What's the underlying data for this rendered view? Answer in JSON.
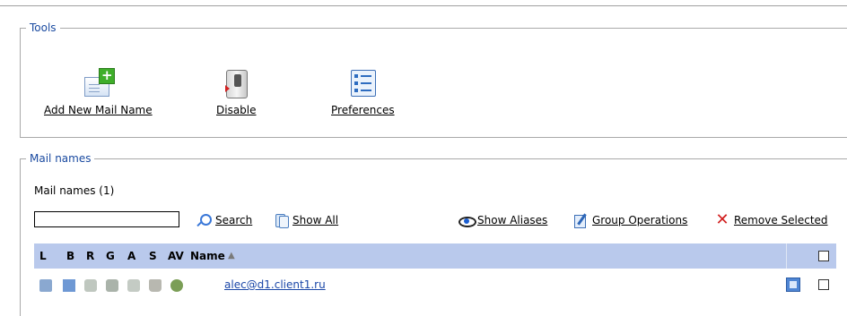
{
  "tools": {
    "legend": "Tools",
    "items": [
      {
        "label": "Add New Mail Name",
        "icon": "add-mail-icon"
      },
      {
        "label": "Disable",
        "icon": "switch-icon"
      },
      {
        "label": "Preferences",
        "icon": "preferences-icon"
      }
    ]
  },
  "mail_names": {
    "legend": "Mail names",
    "count_label": "Mail names (1)",
    "search": {
      "value": "",
      "button_label": "Search"
    },
    "actions": {
      "show_all": "Show All",
      "show_aliases": "Show Aliases",
      "group_operations": "Group Operations",
      "remove_selected": "Remove Selected"
    },
    "table": {
      "columns": [
        "L",
        "B",
        "R",
        "G",
        "A",
        "S",
        "AV",
        "Name"
      ],
      "sort_indicator": "▲",
      "rows": [
        {
          "name": "alec@d1.client1.ru",
          "icons": [
            "mailbox-icon",
            "mail-icon",
            "redirect-icon",
            "group-icon",
            "autoresponder-icon",
            "spam-icon",
            "antivirus-icon"
          ]
        }
      ]
    }
  },
  "colors": {
    "header_bg": "#b9c9ec",
    "legend_text": "#1a4aa0",
    "link": "#1b47a8",
    "remove": "#d11f1f"
  }
}
